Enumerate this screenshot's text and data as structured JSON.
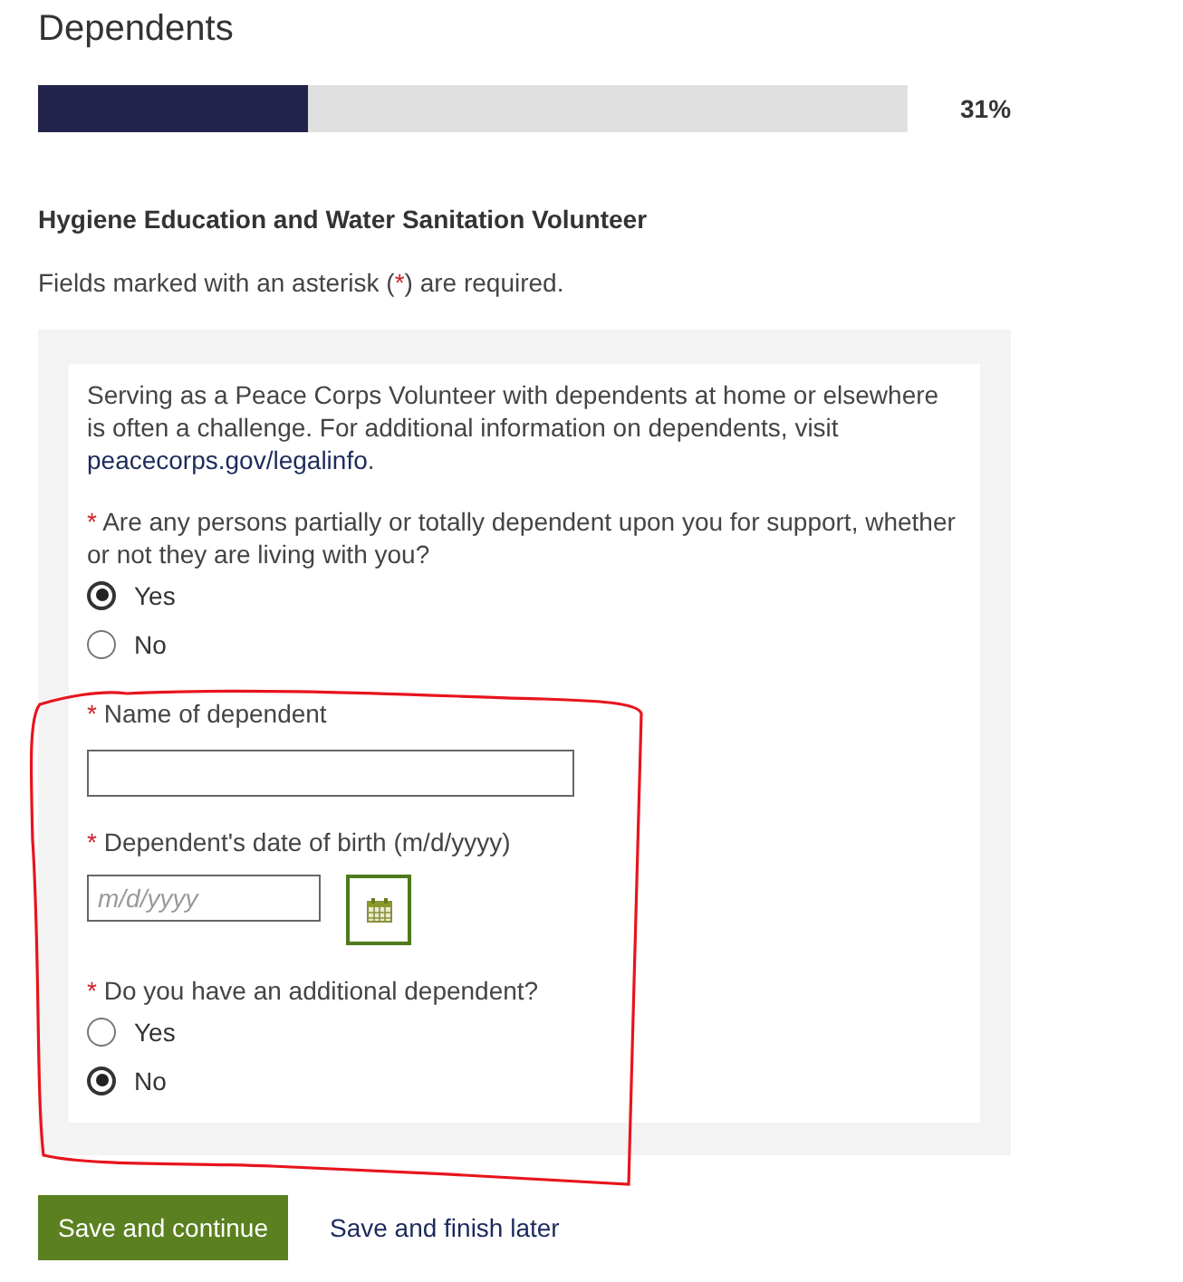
{
  "page_title": "Dependents",
  "progress": {
    "level": 0.31,
    "reading": "31%"
  },
  "position_title": "Hygiene Education and Water Sanitation Volunteer",
  "required_note": {
    "before": "Fields marked with an asterisk (",
    "marker": "*",
    "after": ") are required."
  },
  "intro": {
    "before": "Serving as a Peace Corps Volunteer with dependents at home or elsewhere is often a challenge. For additional information on dependents, visit ",
    "link": "peacecorps.gov/legalinfo",
    "after": "."
  },
  "fields": [
    {
      "kind": "radio",
      "required_mark": "*",
      "label": "Are any persons partially or totally dependent upon you for support, whether or not they are living with you?",
      "options": [
        {
          "label": "Yes",
          "selected": true
        },
        {
          "label": "No",
          "selected": false
        }
      ]
    },
    {
      "kind": "text",
      "required_mark": "*",
      "label": "Name of dependent"
    },
    {
      "kind": "date",
      "required_mark": "*",
      "label": "Dependent's date of birth (m/d/yyyy)",
      "placeholder": "m/d/yyyy"
    },
    {
      "kind": "radio",
      "required_mark": "*",
      "label": "Do you have an additional dependent?",
      "options": [
        {
          "label": "Yes",
          "selected": false
        },
        {
          "label": "No",
          "selected": true
        }
      ]
    }
  ],
  "buttons": [
    {
      "kind": "primary",
      "label": "Save and continue"
    },
    {
      "kind": "link",
      "label": "Save and finish later"
    }
  ]
}
